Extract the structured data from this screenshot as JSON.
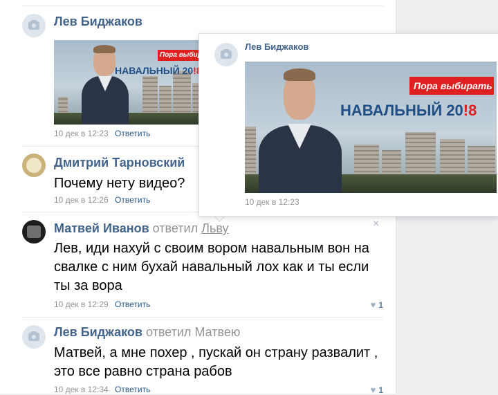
{
  "comments": [
    {
      "author": "Лев Биджаков",
      "date": "10 дек в 12:23",
      "reply_label": "Ответить",
      "banner": {
        "badge": "Пора выбирать",
        "slogan_name": "НАВАЛЬНЫЙ 20",
        "slogan_year": "!8"
      }
    },
    {
      "author": "Дмитрий Тарновский",
      "text": "Почему нету видео?",
      "date": "10 дек в 12:26",
      "reply_label": "Ответить"
    },
    {
      "author": "Матвей Иванов",
      "replied_word": "ответил",
      "replied_to": "Льву",
      "text": "Лев, иди нахуй с своим вором навальным вон на свалке с ним бухай навальный лох как и ты если ты за вора",
      "date": "10 дек в 12:29",
      "reply_label": "Ответить",
      "likes": "1",
      "close_glyph": "×"
    },
    {
      "author": "Лев Биджаков",
      "replied_word": "ответил",
      "replied_to": "Матвею",
      "text": "Матвей, а мне похер , пускай он страну развалит , это все равно страна рабов",
      "date": "10 дек в 12:34",
      "reply_label": "Ответить",
      "likes": "1"
    }
  ],
  "popup": {
    "author": "Лев Биджаков",
    "date": "10 дек в 12:23",
    "banner": {
      "badge": "Пора выбирать",
      "slogan_name": "НАВАЛЬНЫЙ 20",
      "slogan_year": "!8"
    }
  },
  "icons": {
    "heart": "♥",
    "avatar_placeholder": "camera-icon"
  },
  "colors": {
    "link": "#42648b",
    "accent_red": "#e02020",
    "meta": "#939393"
  }
}
